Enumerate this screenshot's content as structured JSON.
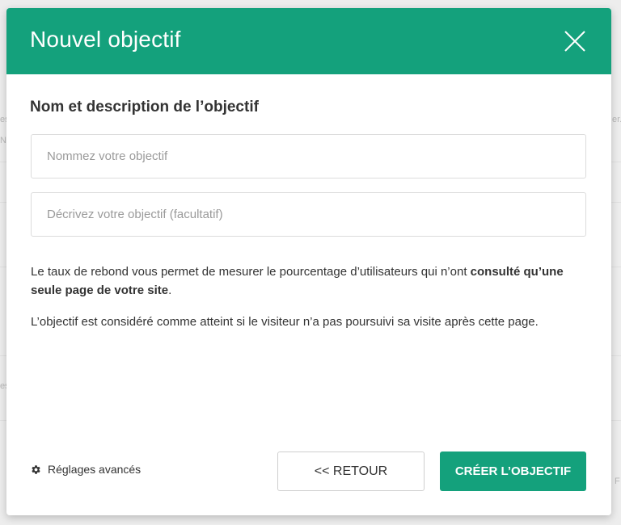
{
  "background": {
    "fragments": [
      "es",
      "N",
      "es",
      "er.",
      "F"
    ]
  },
  "modal": {
    "title": "Nouvel objectif",
    "close_icon": "close-icon",
    "section_title": "Nom et description de l’objectif",
    "name_input": {
      "placeholder": "Nommez votre objectif",
      "value": ""
    },
    "description_input": {
      "placeholder": "Décrivez votre objectif (facultatif)",
      "value": ""
    },
    "paragraph1": {
      "before": "Le taux de rebond vous permet de mesurer le pourcentage d’utilisateurs qui n’ont ",
      "bold": "consulté qu’une seule page de votre site",
      "after": "."
    },
    "paragraph2": "L’objectif est considéré comme atteint si le visiteur n’a pas poursuivi sa visite après cette page.",
    "footer": {
      "advanced_label": "Réglages avancés",
      "advanced_icon": "gear-icon",
      "back_label": "<< RETOUR",
      "create_label": "CRÉER L’OBJECTIF"
    }
  },
  "colors": {
    "accent": "#14a17c",
    "text": "#333333",
    "border": "#dcdcdc"
  }
}
